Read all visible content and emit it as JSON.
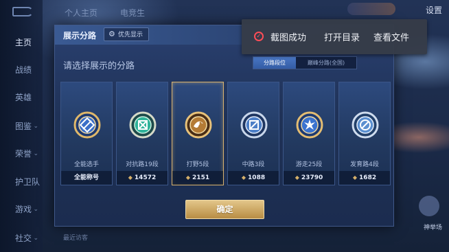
{
  "background": {
    "top_tabs": [
      "个人主页",
      "电竞生"
    ],
    "settings_label": "设置",
    "sidebar_items": [
      {
        "label": "主页",
        "chevron": false
      },
      {
        "label": "战绩",
        "chevron": false
      },
      {
        "label": "英雄",
        "chevron": false
      },
      {
        "label": "图鉴",
        "chevron": true
      },
      {
        "label": "荣誉",
        "chevron": true
      },
      {
        "label": "护卫队",
        "chevron": true
      },
      {
        "label": "游戏",
        "chevron": true
      },
      {
        "label": "社交",
        "chevron": true
      }
    ],
    "recent_visitors_label": "最近访客",
    "right_widget_label": "神举场"
  },
  "modal": {
    "title": "展示分路",
    "priority_label": "优先显示",
    "subtitle": "请选择展示的分路",
    "segment_options": [
      {
        "label": "分路段位",
        "active": true
      },
      {
        "label": "巅峰分路(全国)",
        "active": false
      }
    ],
    "cards": [
      {
        "label": "全能选手",
        "footer": "全能称号",
        "show_diamond": false,
        "selected": false,
        "icon": "all-round-emblem-icon"
      },
      {
        "label": "对抗路19段",
        "footer": "14572",
        "show_diamond": true,
        "selected": false,
        "icon": "clash-lane-emblem-icon"
      },
      {
        "label": "打野5段",
        "footer": "2151",
        "show_diamond": true,
        "selected": true,
        "icon": "jungle-emblem-icon"
      },
      {
        "label": "中路3段",
        "footer": "1088",
        "show_diamond": true,
        "selected": false,
        "icon": "mid-lane-emblem-icon"
      },
      {
        "label": "游走25段",
        "footer": "23790",
        "show_diamond": true,
        "selected": false,
        "icon": "roam-emblem-icon"
      },
      {
        "label": "发育路4段",
        "footer": "1682",
        "show_diamond": true,
        "selected": false,
        "icon": "farm-lane-emblem-icon"
      }
    ],
    "confirm_label": "确定"
  },
  "toast": {
    "status_icon": "screenshot-success-icon",
    "message": "截图成功",
    "open_folder_label": "打开目录",
    "view_file_label": "查看文件"
  },
  "colors": {
    "gold_accent": "#d9b26e",
    "segment_active": "#3d69b5",
    "toast_icon_red": "#ff4d57"
  }
}
